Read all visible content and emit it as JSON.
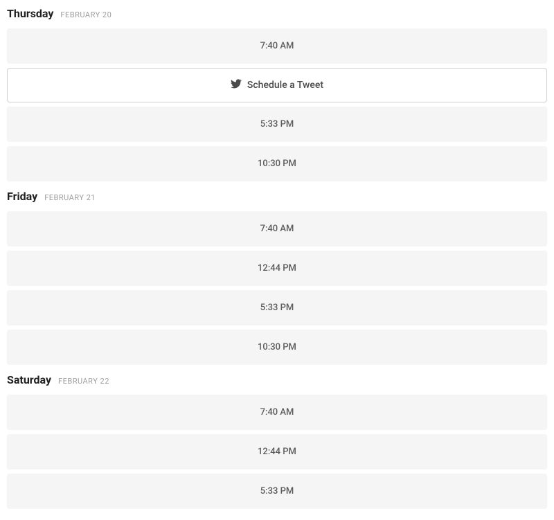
{
  "days": [
    {
      "name": "Thursday",
      "date": "FEBRUARY 20",
      "slots": [
        {
          "type": "time",
          "label": "7:40 AM"
        },
        {
          "type": "schedule",
          "label": "Schedule a Tweet"
        },
        {
          "type": "time",
          "label": "5:33 PM"
        },
        {
          "type": "time",
          "label": "10:30 PM"
        }
      ]
    },
    {
      "name": "Friday",
      "date": "FEBRUARY 21",
      "slots": [
        {
          "type": "time",
          "label": "7:40 AM"
        },
        {
          "type": "time",
          "label": "12:44 PM"
        },
        {
          "type": "time",
          "label": "5:33 PM"
        },
        {
          "type": "time",
          "label": "10:30 PM"
        }
      ]
    },
    {
      "name": "Saturday",
      "date": "FEBRUARY 22",
      "slots": [
        {
          "type": "time",
          "label": "7:40 AM"
        },
        {
          "type": "time",
          "label": "12:44 PM"
        },
        {
          "type": "time",
          "label": "5:33 PM"
        }
      ]
    }
  ]
}
